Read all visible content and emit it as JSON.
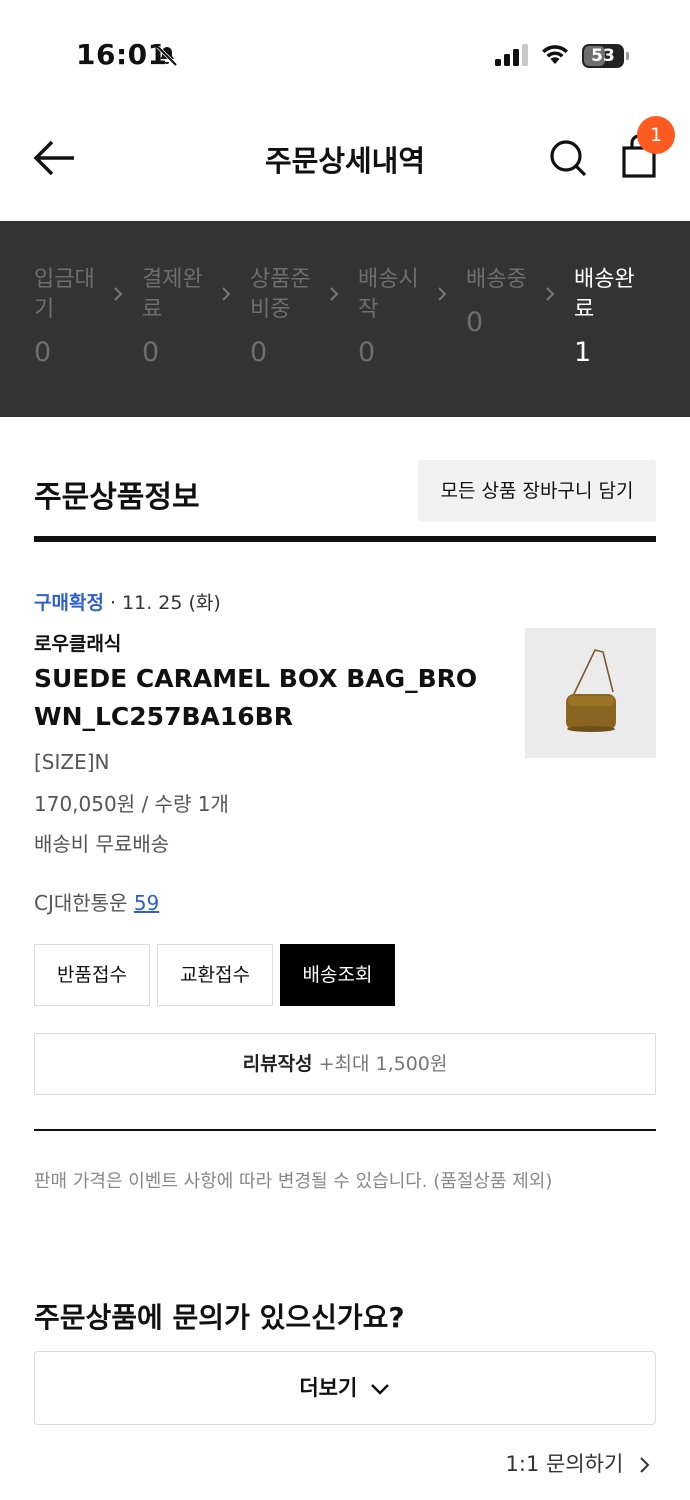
{
  "status_bar": {
    "time": "16:01",
    "battery": "53"
  },
  "header": {
    "title": "주문상세내역",
    "cart_badge": "1"
  },
  "progress": {
    "steps": [
      {
        "label": "입금대기",
        "count": "0"
      },
      {
        "label": "결제완료",
        "count": "0"
      },
      {
        "label": "상품준비중",
        "count": "0"
      },
      {
        "label": "배송시작",
        "count": "0"
      },
      {
        "label": "배송중",
        "count": "0"
      },
      {
        "label": "배송완료",
        "count": "1"
      }
    ]
  },
  "section": {
    "title": "주문상품정보",
    "cart_all_label": "모든 상품 장바구니 담기"
  },
  "order": {
    "status": "구매확정",
    "date": " · 11. 25 (화)",
    "brand": "로우클래식",
    "product_name": "SUEDE CARAMEL BOX BAG_BROWN_LC257BA16BR",
    "size": "[SIZE]N",
    "price_qty": "170,050원 / 수량 1개",
    "shipping": "배송비 무료배송",
    "courier": "CJ대한통운",
    "tracking": "59"
  },
  "actions": {
    "return_label": "반품접수",
    "exchange_label": "교환접수",
    "track_label": "배송조회",
    "review_label": "리뷰작성",
    "review_bonus": " +최대 1,500원"
  },
  "notice": "판매 가격은 이벤트 사항에 따라 변경될 수 있습니다. (품절상품 제외)",
  "inquiry": {
    "title": "주문상품에 문의가 있으신가요?",
    "more_label": "더보기",
    "one_to_one_label": "1:1 문의하기"
  }
}
